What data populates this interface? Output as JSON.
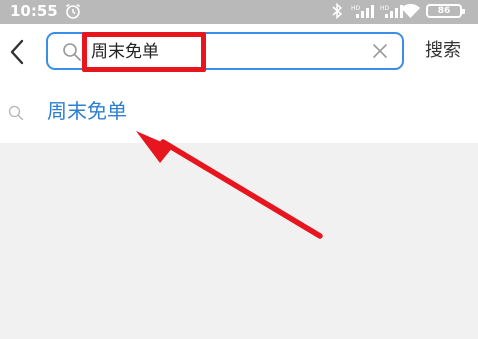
{
  "status_bar": {
    "time": "10:55",
    "battery": "86"
  },
  "search": {
    "query": "周末免单",
    "search_button_label": "搜索"
  },
  "suggestions": [
    {
      "label": "周末免单"
    }
  ],
  "colors": {
    "accent": "#3a8ee6",
    "suggestion_text": "#2e7fd1",
    "annotation": "#e7151d"
  },
  "icons": [
    "alarm-icon",
    "bluetooth-icon",
    "signal-icon",
    "wifi-icon",
    "battery-icon",
    "back-icon",
    "search-icon",
    "clear-icon"
  ]
}
